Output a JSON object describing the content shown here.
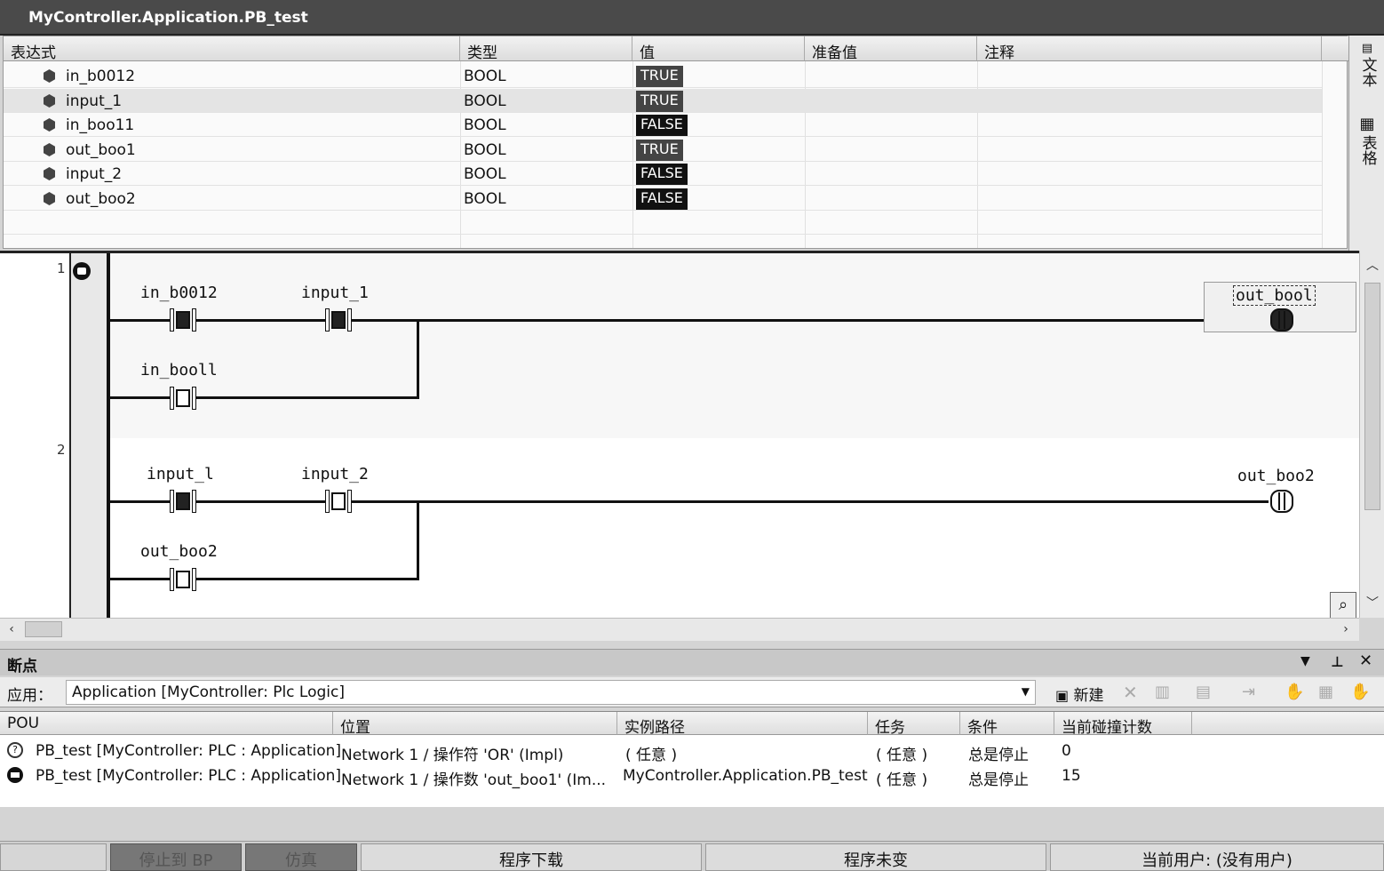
{
  "window": {
    "title": "MyController.Application.PB_test"
  },
  "watch": {
    "columns": [
      "表达式",
      "类型",
      "值",
      "准备值",
      "注释"
    ],
    "rows": [
      {
        "expr": "in_b0012",
        "type": "BOOL",
        "value": "TRUE"
      },
      {
        "expr": "input_1",
        "type": "BOOL",
        "value": "TRUE"
      },
      {
        "expr": "in_boo11",
        "type": "BOOL",
        "value": "FALSE"
      },
      {
        "expr": "out_boo1",
        "type": "BOOL",
        "value": "TRUE"
      },
      {
        "expr": "input_2",
        "type": "BOOL",
        "value": "FALSE"
      },
      {
        "expr": "out_boo2",
        "type": "BOOL",
        "value": "FALSE"
      }
    ]
  },
  "side_tabs": {
    "text": "文本",
    "table": "表格"
  },
  "ladder": {
    "net1": {
      "number": "1",
      "contact_a": {
        "label": "in_b0012",
        "state": "on"
      },
      "contact_b": {
        "label": "input_1",
        "state": "on"
      },
      "contact_c": {
        "label": "in_booll",
        "state": "off"
      },
      "coil": {
        "label": "out_bool",
        "state": "on"
      }
    },
    "net2": {
      "number": "2",
      "contact_a": {
        "label": "input_l",
        "state": "on"
      },
      "contact_b": {
        "label": "input_2",
        "state": "off"
      },
      "contact_c": {
        "label": "out_boo2",
        "state": "off"
      },
      "coil": {
        "label": "out_boo2",
        "state": "off"
      }
    }
  },
  "breakpoints": {
    "title": "断点",
    "app_label": "应用：",
    "app_value": "Application [MyController: Plc Logic]",
    "new_label": "新建",
    "columns": [
      "POU",
      "位置",
      "实例路径",
      "任务",
      "条件",
      "当前碰撞计数"
    ],
    "rows": [
      {
        "pou": "PB_test [MyController: PLC : Application]",
        "location": "Network 1 / 操作符 'OR' (Impl)",
        "instance": "( 任意 )",
        "task": "( 任意 )",
        "condition": "总是停止",
        "count": "0"
      },
      {
        "pou": "PB_test [MyController: PLC : Application]",
        "location": "Network 1 / 操作数 'out_boo1' (Im...",
        "instance": "MyController.Application.PB_test",
        "task": "( 任意 )",
        "condition": "总是停止",
        "count": "15"
      }
    ]
  },
  "statusbar": {
    "stop_bp": "停止到 BP",
    "sim": "仿真",
    "download": "程序下载",
    "unchanged": "程序未变",
    "user": "当前用户: (没有用户)"
  }
}
